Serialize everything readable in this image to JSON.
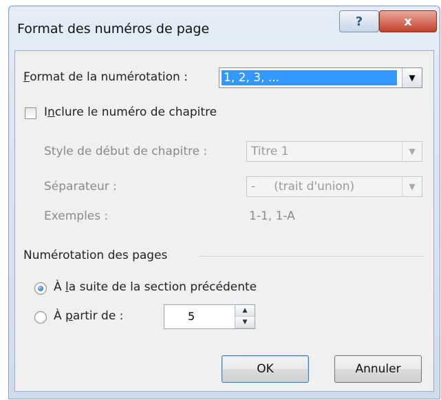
{
  "dialog": {
    "title": "Format des numéros de page",
    "help_button_symbol": "?",
    "close_button_symbol": "x"
  },
  "number_format": {
    "label_accel": "F",
    "label_rest": "ormat de la numérotation :",
    "value": "1, 2, 3, ...",
    "dropdown_arrow": "▼"
  },
  "chapter": {
    "checkbox_label_pre": "I",
    "checkbox_label_accel": "n",
    "checkbox_label_rest": "clure le numéro de chapitre",
    "checked": false,
    "style_label": "Style de début de chapitre :",
    "style_value": "Titre 1",
    "separator_label": "Séparateur :",
    "separator_value": "-     (trait d'union)",
    "examples_label": "Exemples :",
    "examples_value": "1-1, 1-A",
    "dropdown_arrow": "▼"
  },
  "page_numbering": {
    "group_label": "Numérotation des pages",
    "option_continue_pre": "À ",
    "option_continue_accel": "l",
    "option_continue_rest": "a suite de la section précédente",
    "option_start_pre": "À ",
    "option_start_accel": "p",
    "option_start_rest": "artir de :",
    "start_value": "5",
    "spin_up": "▲",
    "spin_down": "▼",
    "selected_option": "continue"
  },
  "buttons": {
    "ok": "OK",
    "cancel": "Annuler"
  },
  "colors": {
    "selection_highlight": "#3399ff",
    "close_button": "#c6402b",
    "dialog_frame": "#cfdcec"
  }
}
